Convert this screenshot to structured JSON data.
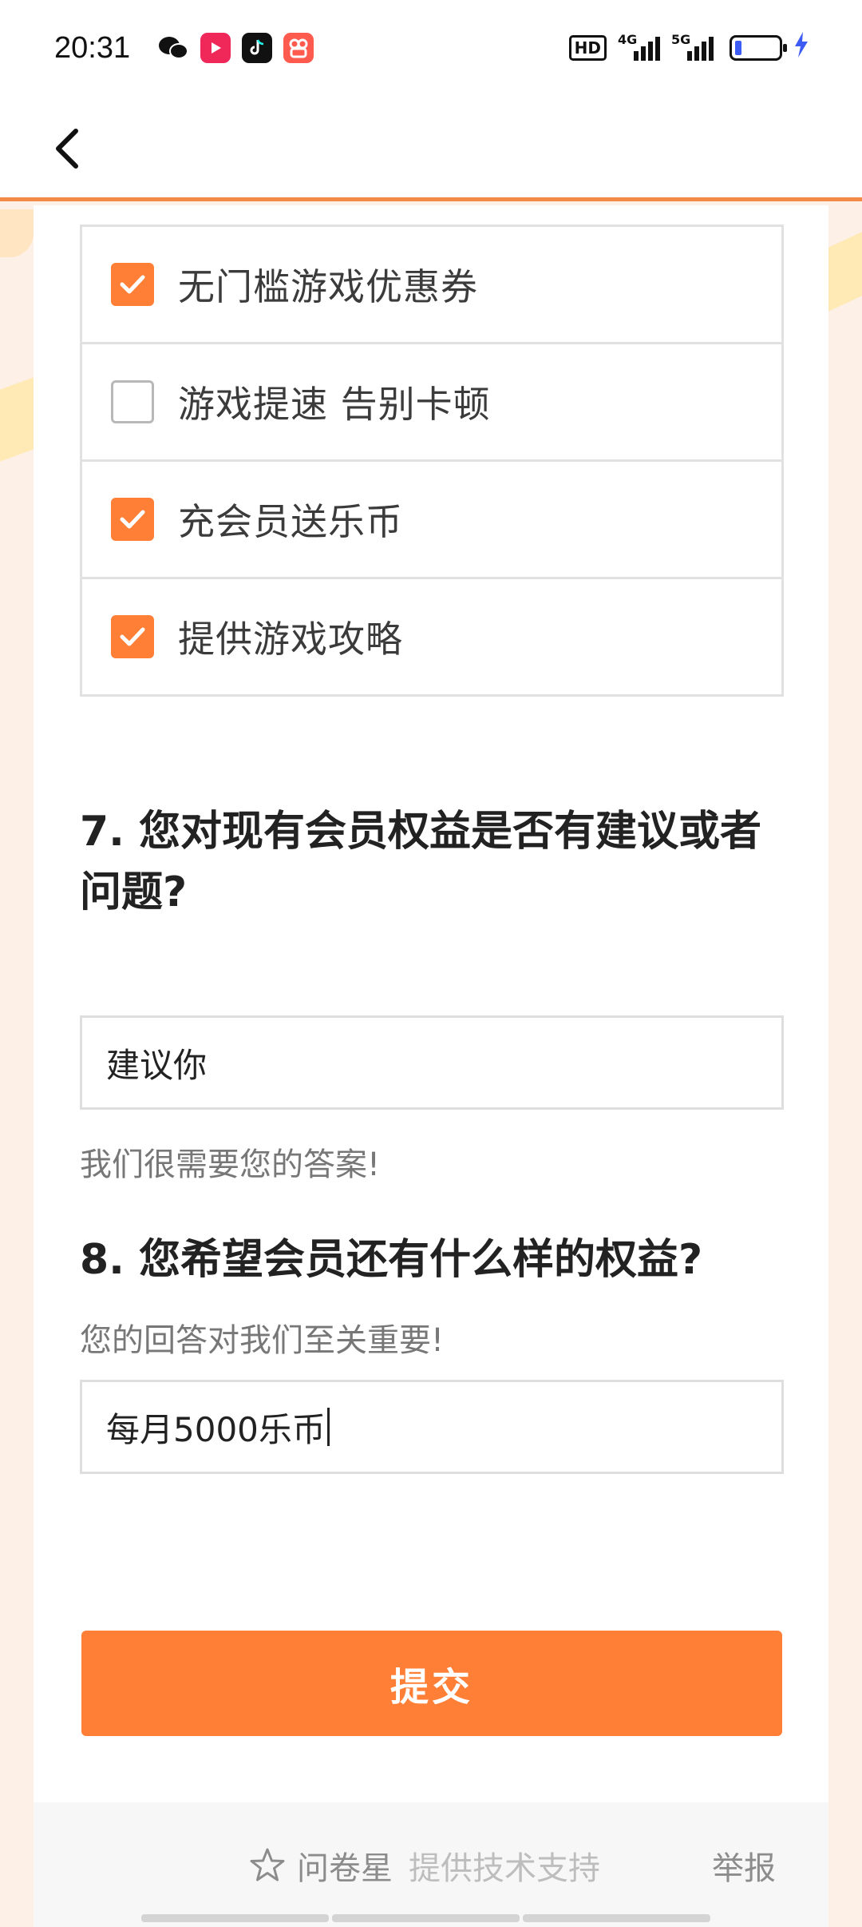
{
  "status_bar": {
    "time": "20:31",
    "apps": [
      "wechat-icon",
      "video-app-icon",
      "tiktok-icon",
      "kuaishou-icon"
    ],
    "hd_label": "HD",
    "net1": "4G",
    "net2": "5G",
    "battery_level_percent": 10
  },
  "nav": {
    "back_icon": "chevron-left-icon"
  },
  "question6": {
    "options": [
      {
        "label": "无门槛游戏优惠券",
        "checked": true
      },
      {
        "label": "游戏提速 告别卡顿",
        "checked": false
      },
      {
        "label": "充会员送乐币",
        "checked": true
      },
      {
        "label": "提供游戏攻略",
        "checked": true
      }
    ]
  },
  "question7": {
    "title": "7. 您对现有会员权益是否有建议或者问题?",
    "hint": "我们很需要您的答案!",
    "answer": "建议你"
  },
  "question8": {
    "title": "8. 您希望会员还有什么样的权益?",
    "hint": "您的回答对我们至关重要!",
    "answer": "每月5000乐币"
  },
  "submit_label": "提交",
  "footer": {
    "brand_name": "问卷星",
    "support_text": "提供技术支持",
    "report_label": "举报"
  },
  "colors": {
    "accent": "#ff7f37",
    "nav_border": "#f08a45",
    "page_bg": "#fdf0e6"
  }
}
